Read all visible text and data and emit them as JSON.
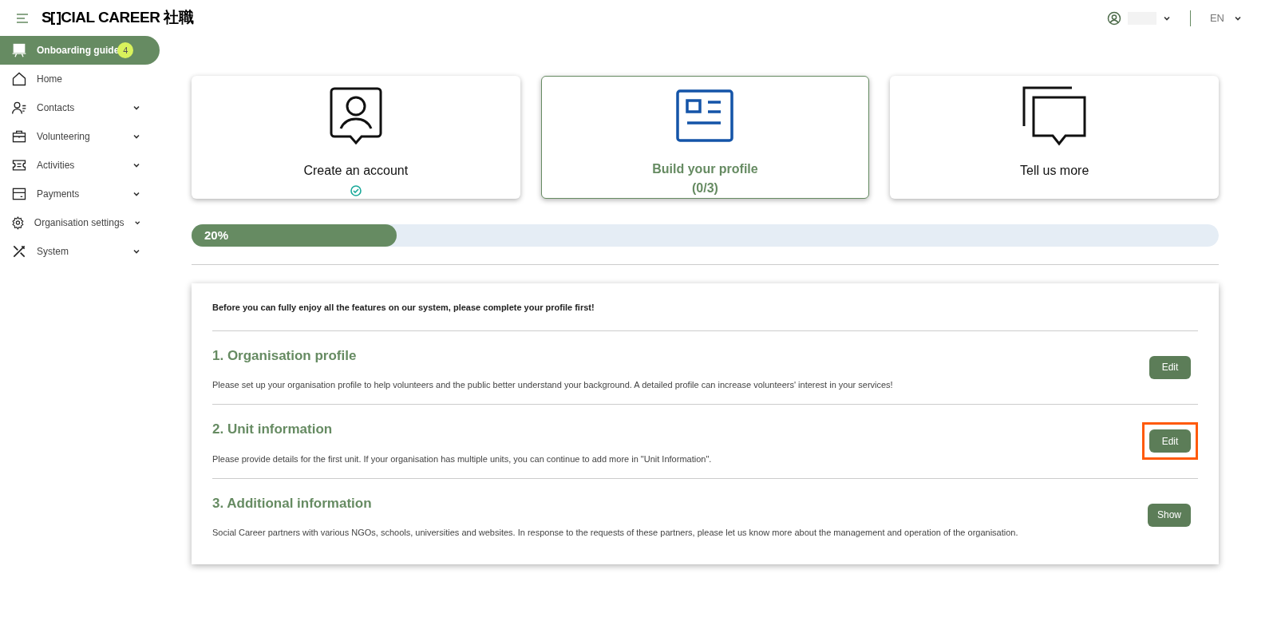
{
  "header": {
    "logo_start": "S",
    "logo_end": "CIAL CAREER 社職",
    "language": "EN"
  },
  "sidebar": {
    "items": [
      {
        "label": "Onboarding guide",
        "kind": "guide",
        "selected": true,
        "badge": "4",
        "expandable": false
      },
      {
        "label": "Home",
        "kind": "home",
        "selected": false,
        "expandable": false
      },
      {
        "label": "Contacts",
        "kind": "contacts",
        "selected": false,
        "expandable": true
      },
      {
        "label": "Volunteering",
        "kind": "briefcase",
        "selected": false,
        "expandable": true
      },
      {
        "label": "Activities",
        "kind": "ticket",
        "selected": false,
        "expandable": true
      },
      {
        "label": "Payments",
        "kind": "wallet",
        "selected": false,
        "expandable": true
      },
      {
        "label": "Organisation settings",
        "kind": "gear",
        "selected": false,
        "expandable": true
      },
      {
        "label": "System",
        "kind": "tools",
        "selected": false,
        "expandable": true
      }
    ]
  },
  "steps": [
    {
      "title": "Create an account",
      "kind": "account",
      "completed": true,
      "selected": false
    },
    {
      "title": "Build your profile",
      "count": "(0/3)",
      "kind": "profile",
      "completed": false,
      "selected": true
    },
    {
      "title": "Tell us more",
      "kind": "chat",
      "completed": false,
      "selected": false
    }
  ],
  "progress": {
    "level": 0.2,
    "reading": "20%"
  },
  "intro": "Before you can fully enjoy all the features on our system, please complete your profile first!",
  "sections": [
    {
      "title": "1. Organisation profile",
      "text": "Please set up your organisation profile to help volunteers and the public better understand your background. A detailed profile can increase volunteers' interest in your services!",
      "button": "Edit",
      "highlighted": false
    },
    {
      "title": "2. Unit information",
      "text": "Please provide details for the first unit. If your organisation has multiple units, you can continue to add more in \"Unit Information\".",
      "button": "Edit",
      "highlighted": true
    },
    {
      "title": "3. Additional information",
      "text": "Social Career partners with various NGOs, schools, universities and websites. In response to the requests of these partners, please let us know more about the management and operation of the organisation.",
      "button": "Show",
      "highlighted": false
    }
  ]
}
